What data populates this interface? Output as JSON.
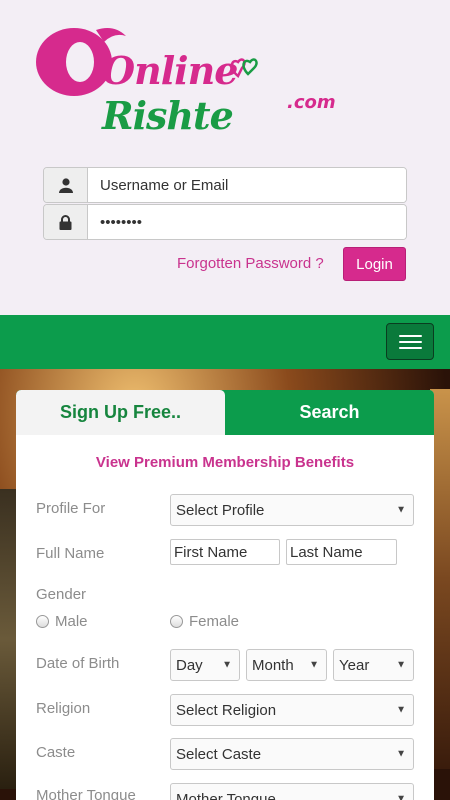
{
  "logo": {
    "part1": "Online",
    "part2": "Rishte",
    "domain_suffix": ".com",
    "colors": {
      "pink": "#d62a8d",
      "green": "#1a9c45"
    }
  },
  "login": {
    "username_placeholder": "Username or Email",
    "password_value": "••••••••",
    "forgot_label": "Forgotten Password ?",
    "login_label": "Login",
    "user_icon": "user-icon",
    "lock_icon": "lock-icon"
  },
  "nav": {
    "menu_icon": "hamburger-menu-icon",
    "bar_color": "#0c9c4c"
  },
  "form": {
    "tabs": [
      {
        "label": "Sign Up Free..",
        "active": true
      },
      {
        "label": "Search",
        "active": false
      }
    ],
    "benefits_link": "View Premium Membership Benefits",
    "profile_for": {
      "label": "Profile For",
      "value": "Select Profile"
    },
    "full_name": {
      "label": "Full Name",
      "first_placeholder": "First Name",
      "last_placeholder": "Last Name"
    },
    "gender": {
      "label": "Gender",
      "options": [
        "Male",
        "Female"
      ]
    },
    "dob": {
      "label": "Date of Birth",
      "day": "Day",
      "month": "Month",
      "year": "Year"
    },
    "religion": {
      "label": "Religion",
      "value": "Select Religion"
    },
    "caste": {
      "label": "Caste",
      "value": "Select Caste"
    },
    "mother_tongue": {
      "label": "Mother Tongue",
      "value": "Mother Tongue"
    }
  }
}
